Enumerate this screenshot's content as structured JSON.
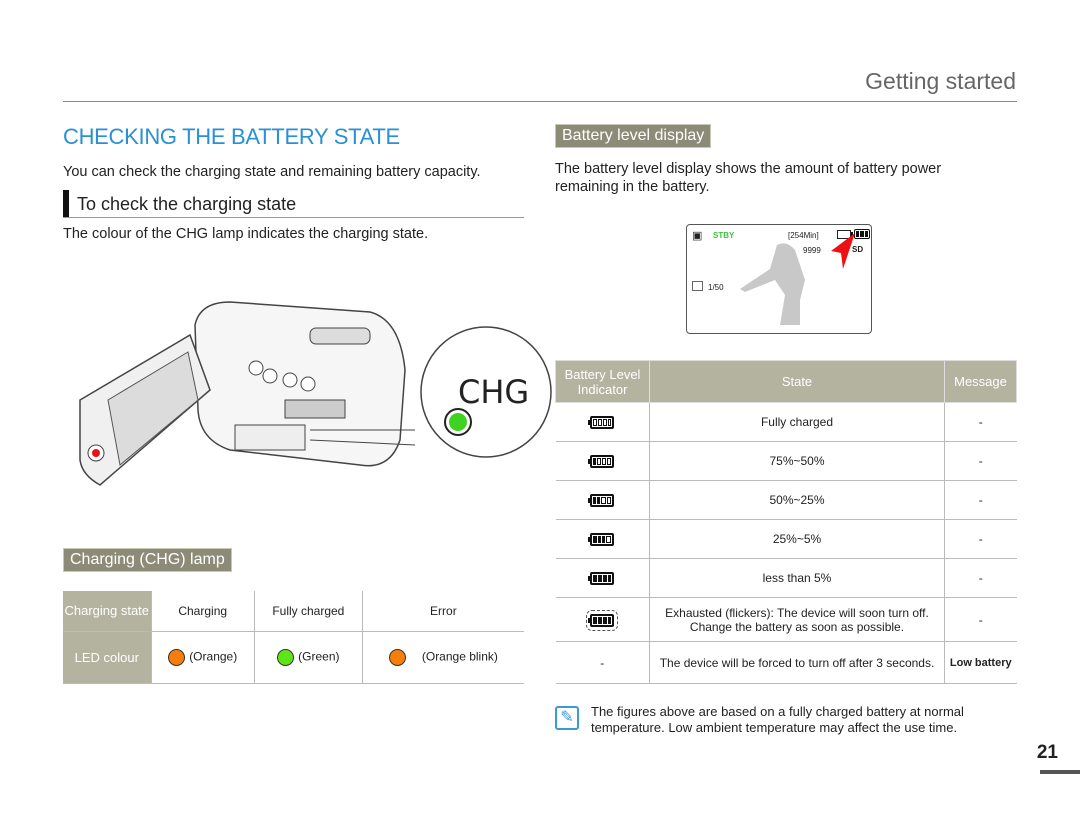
{
  "header": {
    "section": "Getting started"
  },
  "title": "CHECKING THE BATTERY STATE",
  "intro": "You can check the charging state and remaining battery capacity.",
  "subheading": "To check the charging state",
  "subtext": "The colour of the CHG lamp indicates the charging state.",
  "illustration": {
    "lamp_label": "CHG",
    "lamp_color": "#3fd321"
  },
  "chg_lamp": {
    "label": "Charging (CHG) lamp",
    "row_headers": [
      "Charging state",
      "LED colour"
    ],
    "states": [
      "Charging",
      "Fully charged",
      "Error"
    ],
    "colours": [
      {
        "label": "(Orange)",
        "color": "#f77e0c"
      },
      {
        "label": "(Green)",
        "color": "#5ee51a"
      },
      {
        "label": "(Orange blink)",
        "color": "#f77e0c"
      }
    ]
  },
  "battery_display": {
    "label": "Battery level display",
    "text": "The battery level display shows the amount of battery power remaining in the battery.",
    "screen": {
      "mode": "STBY",
      "time": "[254Min]",
      "count": "9999",
      "media": "SD",
      "photo": "1/50"
    }
  },
  "battery_table": {
    "headers": [
      "Battery Level Indicator",
      "State",
      "Message"
    ],
    "rows": [
      {
        "level": 4,
        "state": "Fully charged",
        "message": "-"
      },
      {
        "level": 3,
        "state": "75%~50%",
        "message": "-"
      },
      {
        "level": 2,
        "state": "50%~25%",
        "message": "-"
      },
      {
        "level": 1,
        "state": "25%~5%",
        "message": "-"
      },
      {
        "level": 0,
        "state": "less than 5%",
        "message": "-"
      },
      {
        "level": 0,
        "flicker": true,
        "state": "Exhausted (flickers): The device will soon turn off.",
        "state2": "Change the battery as soon as possible.",
        "message": "-"
      },
      {
        "indicator": "-",
        "state": "The device will be forced to turn off after 3 seconds.",
        "message": "Low battery"
      }
    ]
  },
  "note": "The figures above are based on a fully charged battery at normal temperature. Low ambient temperature may affect the use time.",
  "page_number": "21"
}
